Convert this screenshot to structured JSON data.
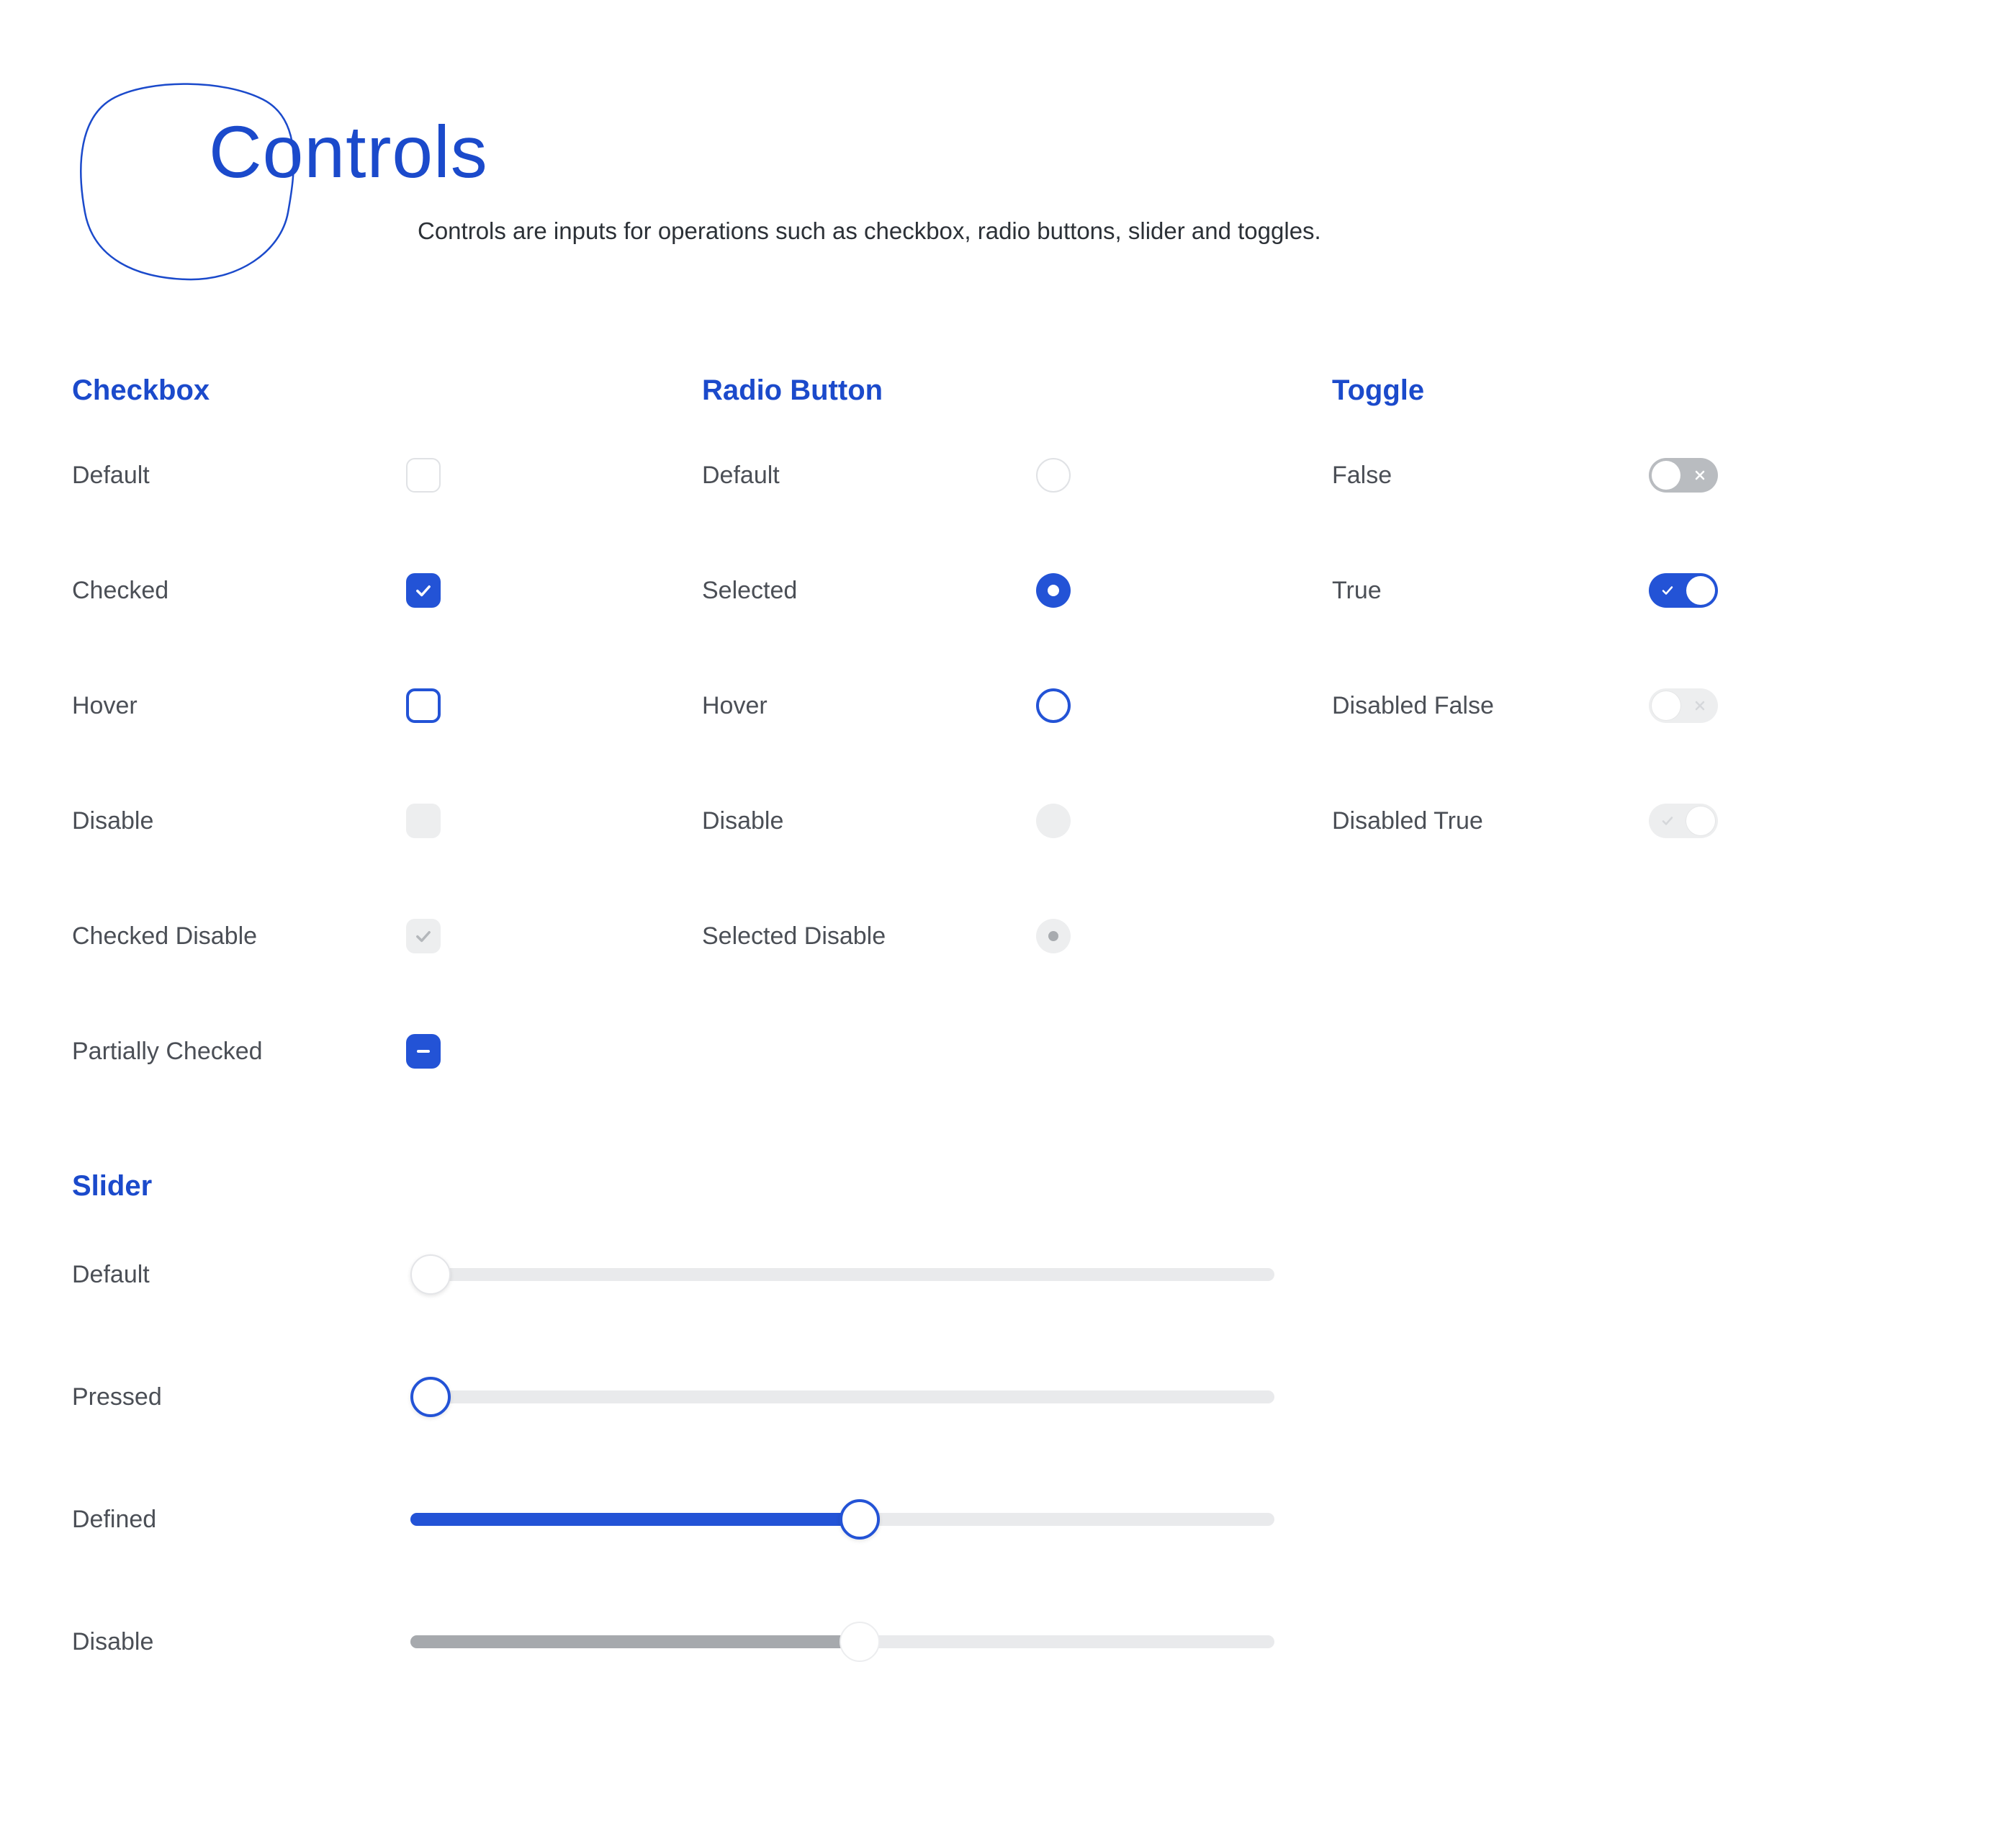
{
  "header": {
    "title": "Controls",
    "subtitle": "Controls are inputs for operations such as checkbox, radio buttons, slider and toggles."
  },
  "checkbox": {
    "title": "Checkbox",
    "states": [
      {
        "label": "Default"
      },
      {
        "label": "Checked"
      },
      {
        "label": "Hover"
      },
      {
        "label": "Disable"
      },
      {
        "label": "Checked Disable"
      },
      {
        "label": "Partially Checked"
      }
    ]
  },
  "radio": {
    "title": "Radio Button",
    "states": [
      {
        "label": "Default"
      },
      {
        "label": "Selected"
      },
      {
        "label": "Hover"
      },
      {
        "label": "Disable"
      },
      {
        "label": "Selected Disable"
      }
    ]
  },
  "toggle": {
    "title": "Toggle",
    "states": [
      {
        "label": "False"
      },
      {
        "label": "True"
      },
      {
        "label": "Disabled False"
      },
      {
        "label": "Disabled True"
      }
    ]
  },
  "slider": {
    "title": "Slider",
    "states": [
      {
        "label": "Default",
        "value_percent": 0,
        "disabled": false,
        "pressed": false
      },
      {
        "label": "Pressed",
        "value_percent": 0,
        "disabled": false,
        "pressed": true
      },
      {
        "label": "Defined",
        "value_percent": 52,
        "disabled": false,
        "pressed": true
      },
      {
        "label": "Disable",
        "value_percent": 52,
        "disabled": true,
        "pressed": false
      }
    ]
  },
  "colors": {
    "primary": "#1B4ACB",
    "primary_bright": "#2353D6",
    "gray_track": "#E9EAEC",
    "gray_mid": "#B9BCC0"
  }
}
